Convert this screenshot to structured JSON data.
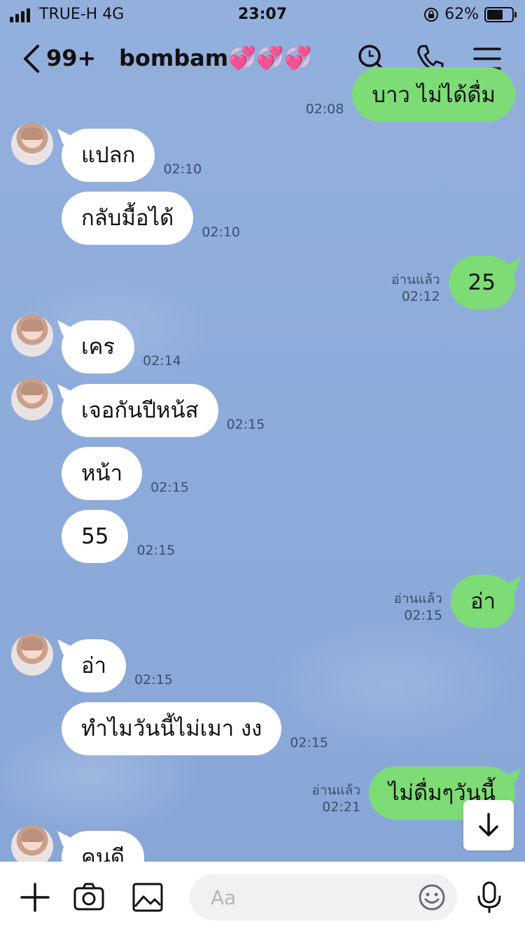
{
  "status_bar": {
    "carrier": "TRUE-H  4G",
    "time": "23:07",
    "battery": "62%"
  },
  "header": {
    "unread_count": "99+",
    "contact_name": "bombam💞💞💞"
  },
  "messages": [
    {
      "side": "out",
      "text": "บาว  ไม่ได้ดื่ม",
      "time": "02:08",
      "read": ""
    },
    {
      "side": "in",
      "text": "แปลก",
      "time": "02:10"
    },
    {
      "side": "in",
      "text": "กลับมื้อได้",
      "time": "02:10"
    },
    {
      "side": "out",
      "text": "25",
      "time": "02:12",
      "read": "อ่านแล้ว"
    },
    {
      "side": "in",
      "text": "เคร",
      "time": "02:14"
    },
    {
      "side": "in",
      "text": "เจอกันปีหน้ส",
      "time": "02:15"
    },
    {
      "side": "in",
      "text": "หน้า",
      "time": "02:15"
    },
    {
      "side": "in",
      "text": "55",
      "time": "02:15"
    },
    {
      "side": "out",
      "text": "อ่า",
      "time": "02:15",
      "read": "อ่านแล้ว"
    },
    {
      "side": "in",
      "text": "อ่า",
      "time": "02:15"
    },
    {
      "side": "in",
      "text": "ทำไมวันนี้ไม่เมา งง",
      "time": "02:15"
    },
    {
      "side": "out",
      "text": "ไม่ดื่มๆวันนี้",
      "time": "02:21",
      "read": "อ่านแล้ว"
    },
    {
      "side": "in",
      "text": "คนดี",
      "time": ""
    }
  ],
  "composer": {
    "placeholder": "Aa"
  },
  "icons": [
    "back-chevron-icon",
    "search-icon",
    "phone-icon",
    "menu-icon",
    "scroll-down-arrow-icon",
    "plus-icon",
    "camera-icon",
    "image-icon",
    "emoji-icon",
    "microphone-icon"
  ]
}
